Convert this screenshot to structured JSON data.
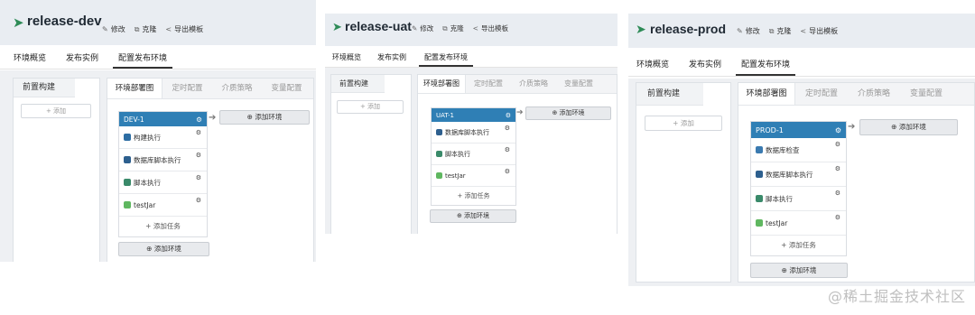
{
  "panels": [
    {
      "title": "release-dev",
      "actions": [
        "修改",
        "克隆",
        "导出模板"
      ],
      "nav_tabs": [
        "环境概览",
        "发布实例",
        "配置发布环境"
      ],
      "pre_build_label": "前置构建",
      "pre_add_label": "+ 添加",
      "deploy_tabs": [
        "环境部署图",
        "定时配置",
        "介质策略",
        "变量配置"
      ],
      "env_name": "DEV-1",
      "tasks": [
        {
          "icon": "build",
          "label": "构建执行"
        },
        {
          "icon": "db",
          "label": "数据库脚本执行"
        },
        {
          "icon": "script",
          "label": "脚本执行"
        },
        {
          "icon": "test",
          "label": "testJar"
        }
      ],
      "add_task_label": "+ 添加任务",
      "add_env_label": "添加环境"
    },
    {
      "title": "release-uat",
      "actions": [
        "修改",
        "克隆",
        "导出模板"
      ],
      "nav_tabs": [
        "环境概览",
        "发布实例",
        "配置发布环境"
      ],
      "pre_build_label": "前置构建",
      "pre_add_label": "+ 添加",
      "deploy_tabs": [
        "环境部署图",
        "定时配置",
        "介质策略",
        "变量配置"
      ],
      "env_name": "UAT-1",
      "tasks": [
        {
          "icon": "db",
          "label": "数据库脚本执行"
        },
        {
          "icon": "script",
          "label": "脚本执行"
        },
        {
          "icon": "test",
          "label": "testJar"
        }
      ],
      "add_task_label": "+ 添加任务",
      "add_env_label": "添加环境"
    },
    {
      "title": "release-prod",
      "actions": [
        "修改",
        "克隆",
        "导出模板"
      ],
      "nav_tabs": [
        "环境概览",
        "发布实例",
        "配置发布环境"
      ],
      "pre_build_label": "前置构建",
      "pre_add_label": "+ 添加",
      "deploy_tabs": [
        "环境部署图",
        "定时配置",
        "介质策略",
        "变量配置"
      ],
      "env_name": "PROD-1",
      "tasks": [
        {
          "icon": "check",
          "label": "数据库检查"
        },
        {
          "icon": "db",
          "label": "数据库脚本执行"
        },
        {
          "icon": "script",
          "label": "脚本执行"
        },
        {
          "icon": "test",
          "label": "testJar"
        }
      ],
      "add_task_label": "+ 添加任务",
      "add_env_label": "添加环境"
    }
  ],
  "watermark": "@稀土掘金技术社区"
}
